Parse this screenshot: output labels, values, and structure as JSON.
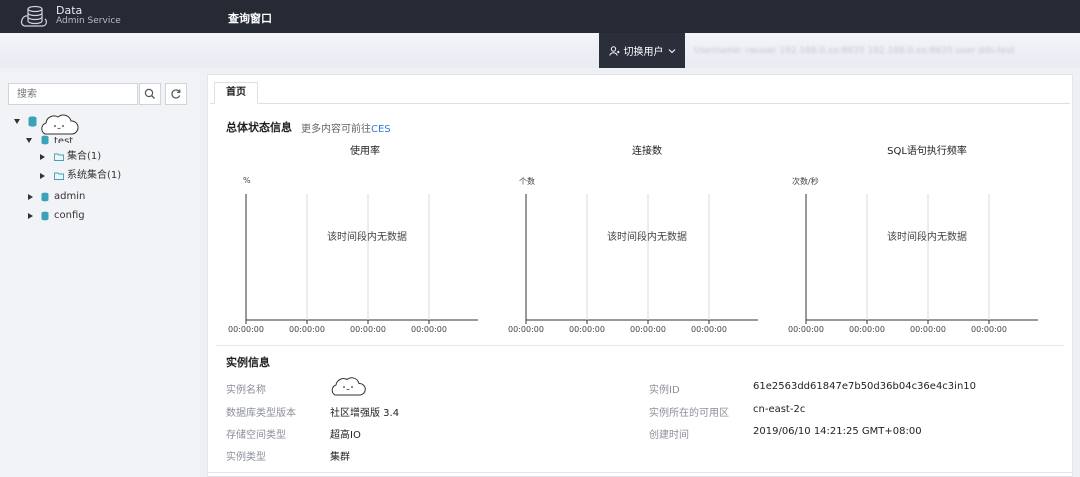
{
  "header": {
    "brand_line1": "Data",
    "brand_line2": "Admin Service",
    "title": "查询窗口"
  },
  "subbar": {
    "switch_user_label": "切换用户",
    "connection_info": "Username: rwuser  192.168.0.xx:8635  192.168.0.xx:8635  user  dds-test"
  },
  "sidebar": {
    "search_placeholder": "搜索",
    "tree": {
      "root_db": "test",
      "children": [
        "集合(1)",
        "系统集合(1)"
      ],
      "other_dbs": [
        "admin",
        "config"
      ]
    }
  },
  "main": {
    "tab_label": "首页",
    "status_title": "总体状态信息",
    "more_prefix": "更多内容可前往",
    "more_link": "CES",
    "charts": [
      {
        "title": "使用率",
        "unit": "%",
        "empty_text": "该时间段内无数据",
        "ticks": [
          "00:00:00",
          "00:00:00",
          "00:00:00",
          "00:00:00"
        ]
      },
      {
        "title": "连接数",
        "unit": "个数",
        "empty_text": "该时间段内无数据",
        "ticks": [
          "00:00:00",
          "00:00:00",
          "00:00:00",
          "00:00:00"
        ]
      },
      {
        "title": "SQL语句执行频率",
        "unit": "次数/秒",
        "empty_text": "该时间段内无数据",
        "ticks": [
          "00:00:00",
          "00:00:00",
          "00:00:00",
          "00:00:00"
        ]
      }
    ],
    "instance_title": "实例信息",
    "instance_left": [
      {
        "label": "实例名称",
        "value": ""
      },
      {
        "label": "数据库类型版本",
        "value": "社区增强版 3.4"
      },
      {
        "label": "存储空间类型",
        "value": "超高IO"
      },
      {
        "label": "实例类型",
        "value": "集群"
      }
    ],
    "instance_right": [
      {
        "label": "实例ID",
        "value": "61e2563dd61847e7b50d36b04c36e4c3in10"
      },
      {
        "label": "实例所在的可用区",
        "value": "cn-east-2c"
      },
      {
        "label": "创建时间",
        "value": "2019/06/10 14:21:25 GMT+08:00"
      }
    ]
  },
  "colors": {
    "topbar": "#262a35",
    "switch_user_bg": "#2b2f3b",
    "link": "#2b7de1",
    "db_icon": "#3aa3b8"
  },
  "chart_data": [
    {
      "type": "line",
      "title": "使用率",
      "ylabel": "%",
      "x": [
        "00:00:00",
        "00:00:00",
        "00:00:00",
        "00:00:00"
      ],
      "series": []
    },
    {
      "type": "line",
      "title": "连接数",
      "ylabel": "个数",
      "x": [
        "00:00:00",
        "00:00:00",
        "00:00:00",
        "00:00:00"
      ],
      "series": []
    },
    {
      "type": "line",
      "title": "SQL语句执行频率",
      "ylabel": "次数/秒",
      "x": [
        "00:00:00",
        "00:00:00",
        "00:00:00",
        "00:00:00"
      ],
      "series": []
    }
  ]
}
